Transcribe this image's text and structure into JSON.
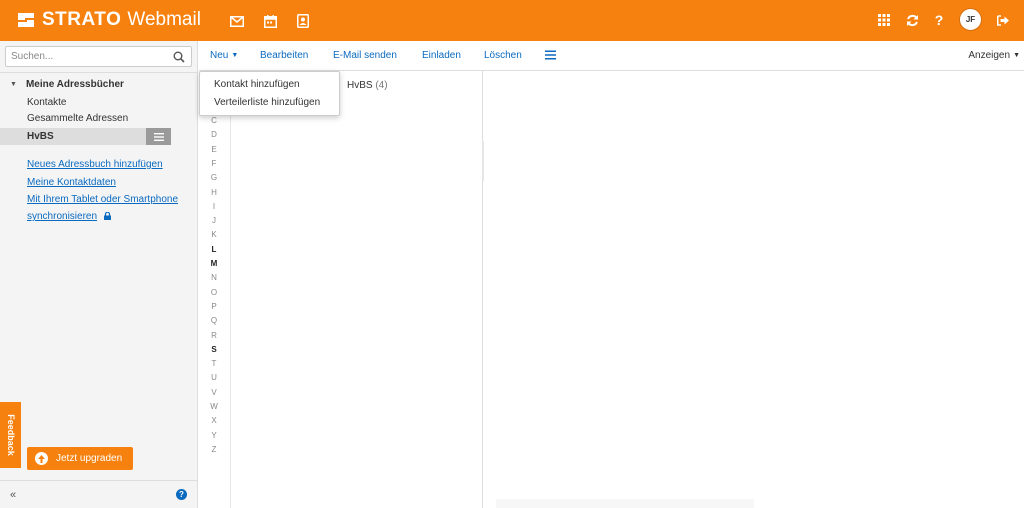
{
  "brand": {
    "name_bold": "STRATO",
    "name_light": "Webmail"
  },
  "header": {
    "app_icons": [
      "mail-icon",
      "calendar-icon",
      "address-book-icon"
    ],
    "right_icons": [
      "apps-grid-icon",
      "refresh-icon",
      "help-icon",
      "logout-icon"
    ],
    "user_initials": "JF"
  },
  "sidebar": {
    "search_placeholder": "Suchen...",
    "tree_title": "Meine Adressbücher",
    "items": [
      "Kontakte",
      "Gesammelte Adressen"
    ],
    "selected_item": "HvBS",
    "links": [
      "Neues Adressbuch hinzufügen",
      "Meine Kontaktdaten",
      "Mit Ihrem Tablet oder Smartphone",
      "synchronisieren"
    ],
    "upgrade_label": "Jetzt upgraden",
    "feedback_label": "Feedback"
  },
  "toolbar": {
    "new_label": "Neu",
    "edit_label": "Bearbeiten",
    "send_email_label": "E-Mail senden",
    "invite_label": "Einladen",
    "delete_label": "Löschen",
    "view_label": "Anzeigen"
  },
  "dropdown": {
    "items": [
      "Kontakt hinzufügen",
      "Verteilerliste hinzufügen"
    ]
  },
  "list": {
    "title": "HvBS",
    "count": "(4)"
  },
  "alphabet": {
    "letters": [
      "C",
      "D",
      "E",
      "F",
      "G",
      "H",
      "I",
      "J",
      "K",
      "L",
      "M",
      "N",
      "O",
      "P",
      "Q",
      "R",
      "S",
      "T",
      "U",
      "V",
      "W",
      "X",
      "Y",
      "Z"
    ],
    "bold_letters": [
      "L",
      "M",
      "S"
    ]
  },
  "colors": {
    "accent": "#f7810e",
    "link": "#0a6ac0"
  }
}
